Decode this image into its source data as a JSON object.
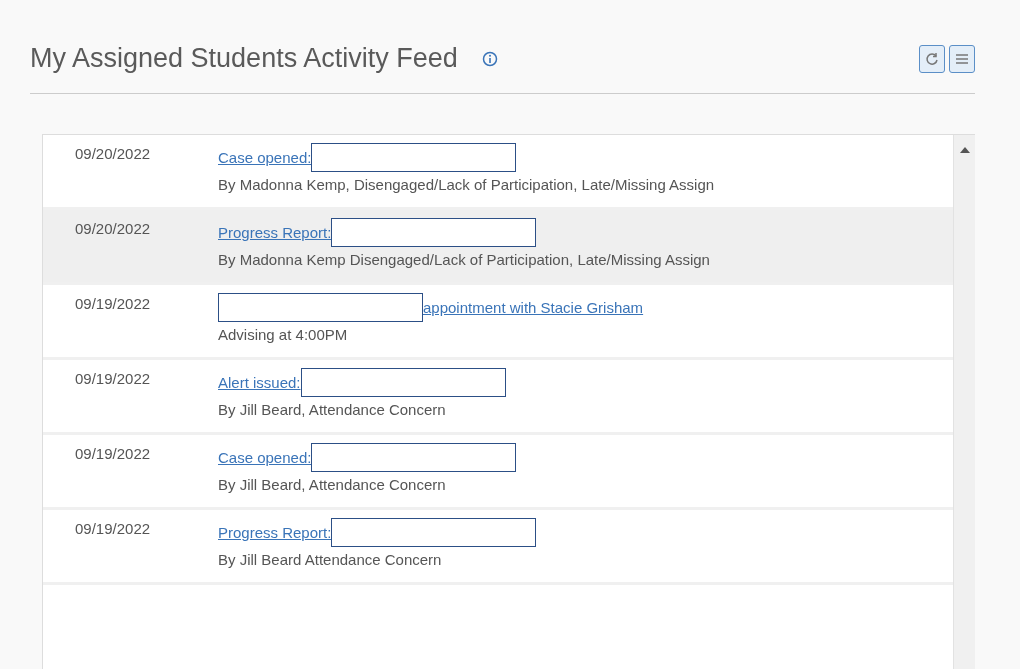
{
  "header": {
    "title": "My Assigned Students Activity Feed"
  },
  "feed": [
    {
      "date": "09/20/2022",
      "link": "Case opened:",
      "redacted_before": false,
      "detail": "By Madonna Kemp, Disengaged/Lack of Participation, Late/Missing Assign",
      "highlighted": false
    },
    {
      "date": "09/20/2022",
      "link": "Progress Report:",
      "redacted_before": false,
      "detail": "By Madonna Kemp Disengaged/Lack of Participation, Late/Missing Assign",
      "highlighted": true
    },
    {
      "date": "09/19/2022",
      "link": "appointment with Stacie Grisham",
      "redacted_before": true,
      "detail": "Advising at 4:00PM",
      "highlighted": false
    },
    {
      "date": "09/19/2022",
      "link": "Alert issued:",
      "redacted_before": false,
      "detail": "By Jill Beard, Attendance Concern",
      "highlighted": false
    },
    {
      "date": "09/19/2022",
      "link": "Case opened:",
      "redacted_before": false,
      "detail": "By Jill Beard, Attendance Concern",
      "highlighted": false
    },
    {
      "date": "09/19/2022",
      "link": "Progress Report:",
      "redacted_before": false,
      "detail": "By Jill Beard Attendance Concern",
      "highlighted": false
    }
  ]
}
